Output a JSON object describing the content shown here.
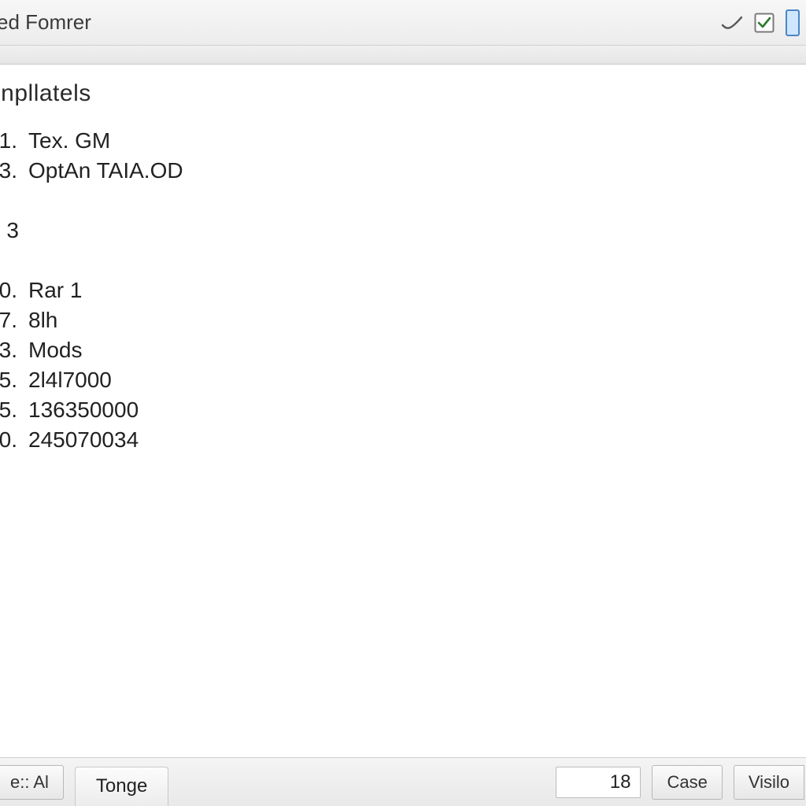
{
  "window": {
    "title": "ed Fomrer"
  },
  "content": {
    "heading": "inpllatels",
    "items": [
      {
        "num": "1.",
        "text": "Tex. GM"
      },
      {
        "num": "3.",
        "text": "OptAn TAIA.OD"
      }
    ],
    "section_marker": "3",
    "items2": [
      {
        "num": "0.",
        "text": "Rar 1"
      },
      {
        "num": "7.",
        "text": "8lh"
      },
      {
        "num": "3.",
        "text": "Mods"
      },
      {
        "num": "5.",
        "text": "2l4l7000"
      },
      {
        "num": "5.",
        "text": "136350000"
      },
      {
        "num": "0.",
        "text": "245070034"
      }
    ]
  },
  "bottombar": {
    "btn_all": "e:: Al",
    "tab_tonge": "Tonge",
    "numeric_value": "18",
    "btn_case": "Case",
    "btn_visilo": "Visilo"
  }
}
